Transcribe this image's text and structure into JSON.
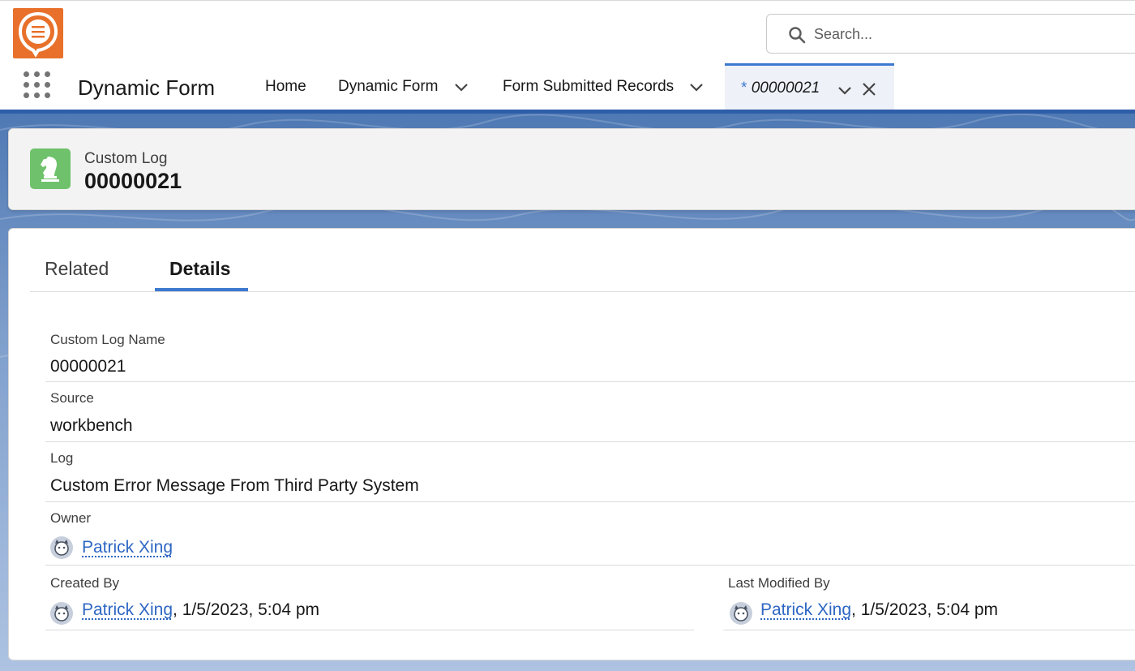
{
  "header": {
    "search_placeholder": "Search..."
  },
  "nav": {
    "app_name": "Dynamic Form",
    "items": [
      {
        "label": "Home"
      },
      {
        "label": "Dynamic Form"
      },
      {
        "label": "Form Submitted Records"
      }
    ],
    "active_tab": {
      "star": "*",
      "label": "00000021"
    }
  },
  "record": {
    "type": "Custom Log",
    "title": "00000021",
    "icon": "chess-knight-icon"
  },
  "detail_tabs": [
    {
      "label": "Related"
    },
    {
      "label": "Details"
    }
  ],
  "fields": {
    "name": {
      "label": "Custom Log Name",
      "value": "00000021"
    },
    "source": {
      "label": "Source",
      "value": "workbench"
    },
    "log": {
      "label": "Log",
      "value": "Custom Error Message From Third Party System"
    },
    "owner": {
      "label": "Owner",
      "user": "Patrick Xing"
    },
    "created_by": {
      "label": "Created By",
      "user": "Patrick Xing",
      "date": ", 1/5/2023, 5:04 pm"
    },
    "last_modified_by": {
      "label": "Last Modified By",
      "user": "Patrick Xing",
      "date": ", 1/5/2023, 5:04 pm"
    }
  },
  "colors": {
    "brand": "#2f5ea9",
    "accent": "#3d79d0",
    "logo": "#e8702a",
    "record_icon": "#6fc26b",
    "link": "#2e67c3"
  }
}
